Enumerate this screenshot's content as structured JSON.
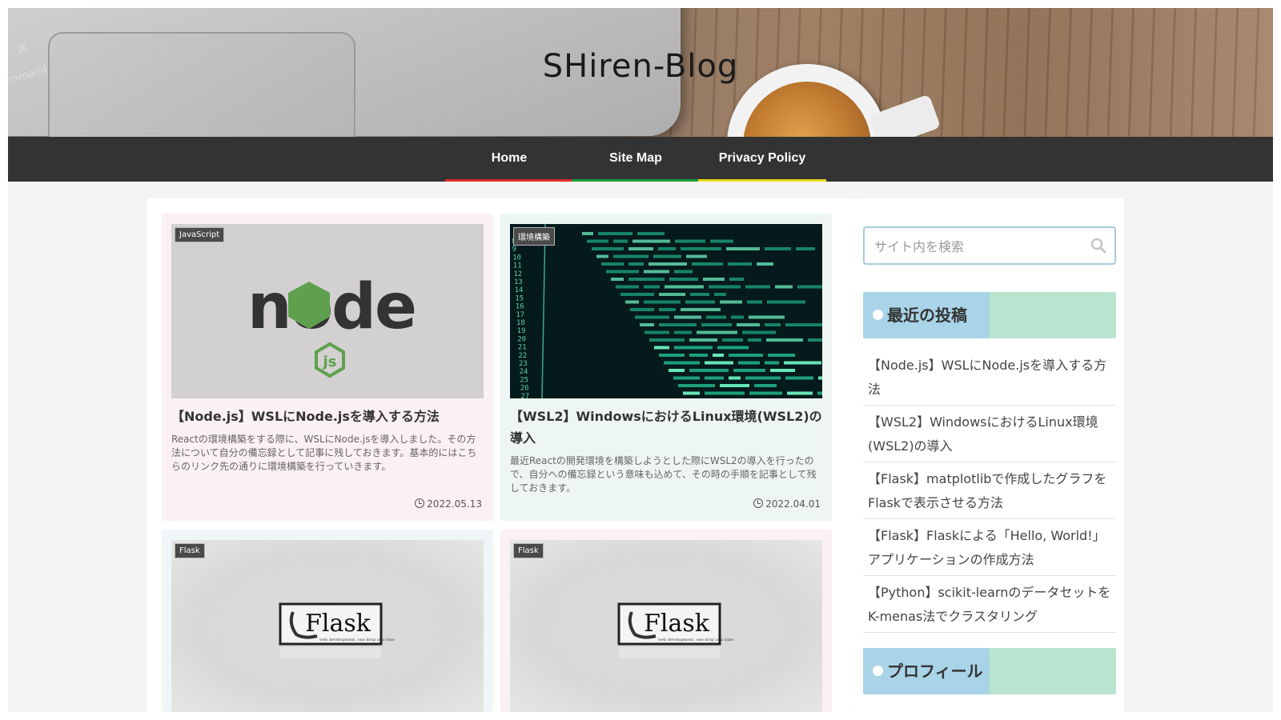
{
  "site": {
    "title": "SHiren-Blog",
    "header_key_labels": [
      "⌘",
      "mmand"
    ]
  },
  "nav": [
    {
      "label": "Home",
      "accent": "#e02b2b"
    },
    {
      "label": "Site Map",
      "accent": "#1a9a3a"
    },
    {
      "label": "Privacy Policy",
      "accent": "#e8d81a"
    }
  ],
  "posts": [
    {
      "category": "JavaScript",
      "title": "【Node.js】WSLにNode.jsを導入する方法",
      "snippet": "Reactの環境構築をする際に、WSLにNode.jsを導入しました。その方法について自分の備忘録として記事に残しておきます。基本的にはこちらのリンク先の通りに環境構築を行っていきます。",
      "date": "2022.05.13",
      "bg": "#fbf0f4",
      "thumb_text": "node",
      "thumb_sub": "js"
    },
    {
      "category": "環境構築",
      "title": "【WSL2】WindowsにおけるLinux環境(WSL2)の導入",
      "snippet": "最近Reactの開発環境を構築しようとした際にWSL2の導入を行ったので、自分への備忘録という意味も込めて、その時の手順を記事として残しておきます。",
      "date": "2022.04.01",
      "bg": "#eef6f3",
      "line_numbers": [
        "8",
        "9",
        "10",
        "11",
        "12",
        "13",
        "14",
        "15",
        "16",
        "17",
        "18",
        "19",
        "20",
        "21",
        "22",
        "23",
        "24",
        "25",
        "26",
        "27"
      ]
    },
    {
      "category": "Flask",
      "bg": "#eff6f7",
      "logo_text": "Flask",
      "logo_sub": "web development, one drop at a time"
    },
    {
      "category": "Flask",
      "bg": "#fbf0f4",
      "logo_text": "Flask",
      "logo_sub": "web development, one drop at a time"
    }
  ],
  "sidebar": {
    "search_placeholder": "サイト内を検索",
    "recent_heading": "最近の投稿",
    "recent_posts": [
      "【Node.js】WSLにNode.jsを導入する方法",
      "【WSL2】WindowsにおけるLinux環境(WSL2)の導入",
      "【Flask】matplotlibで作成したグラフをFlaskで表示させる方法",
      "【Flask】Flaskによる「Hello, World!」アプリケーションの作成方法",
      "【Python】scikit-learnのデータセットをK-menas法でクラスタリング"
    ],
    "profile_heading": "プロフィール"
  },
  "icons": {
    "search": "search-icon",
    "clock": "clock-icon"
  }
}
